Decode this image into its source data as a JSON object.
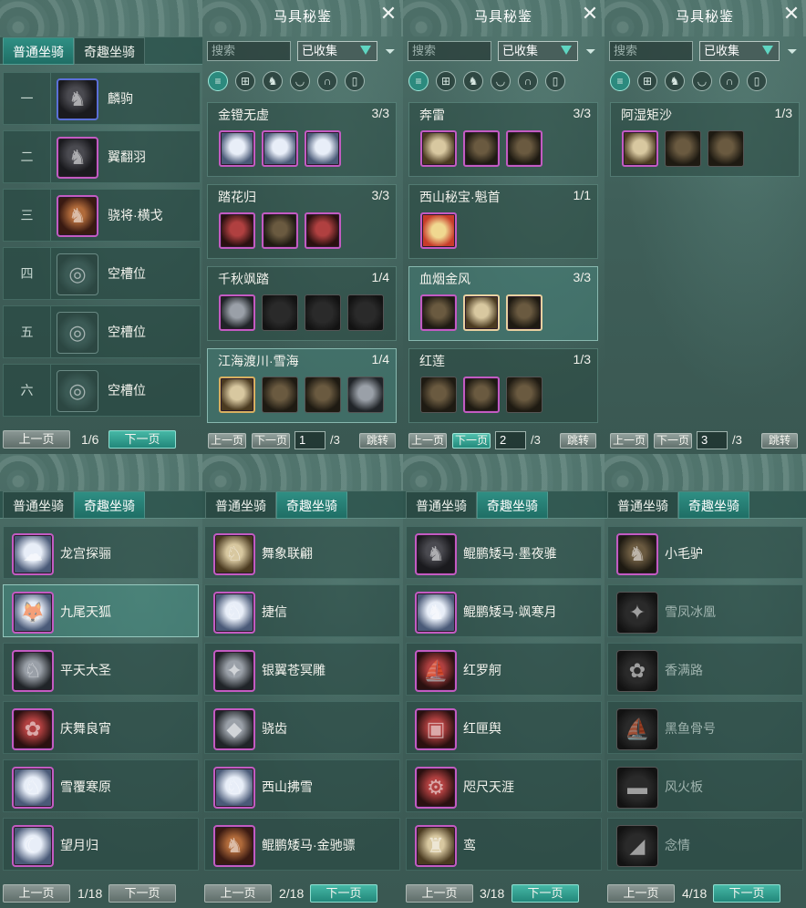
{
  "tabs": {
    "normal": "普通坐骑",
    "fun": "奇趣坐骑"
  },
  "normal_mounts": [
    {
      "num": "一",
      "name": "麟驹",
      "icon": "black-horse-icon"
    },
    {
      "num": "二",
      "name": "翼翻羽",
      "icon": "black-horse-icon"
    },
    {
      "num": "三",
      "name": "骁将·横戈",
      "icon": "war-horse-icon"
    },
    {
      "num": "四",
      "name": "空槽位",
      "icon": "empty-slot-icon"
    },
    {
      "num": "五",
      "name": "空槽位",
      "icon": "empty-slot-icon"
    },
    {
      "num": "六",
      "name": "空槽位",
      "icon": "empty-slot-icon"
    }
  ],
  "normal_pager": {
    "prev": "上一页",
    "next": "下一页",
    "page": "1/6"
  },
  "gear_panels": [
    {
      "title": "马具秘鉴",
      "search_placeholder": "搜索",
      "filter_value": "已收集",
      "page": "1",
      "total": "/3",
      "sets": [
        {
          "name": "金镫无虚",
          "count": "3/3"
        },
        {
          "name": "踏花归",
          "count": "3/3"
        },
        {
          "name": "千秋飒踏",
          "count": "1/4"
        },
        {
          "name": "江海渡川·雪海",
          "count": "1/4"
        }
      ]
    },
    {
      "title": "马具秘鉴",
      "search_placeholder": "搜索",
      "filter_value": "已收集",
      "page": "2",
      "total": "/3",
      "sets": [
        {
          "name": "奔雷",
          "count": "3/3"
        },
        {
          "name": "西山秘宝·魁首",
          "count": "1/1"
        },
        {
          "name": "血烟金风",
          "count": "3/3"
        },
        {
          "name": "红莲",
          "count": "1/3"
        }
      ]
    },
    {
      "title": "马具秘鉴",
      "search_placeholder": "搜索",
      "filter_value": "已收集",
      "page": "3",
      "total": "/3",
      "sets": [
        {
          "name": "阿湿矩沙",
          "count": "1/3"
        }
      ]
    }
  ],
  "gear_pager": {
    "prev": "上一页",
    "next": "下一页",
    "jump": "跳转"
  },
  "fun_panels": [
    {
      "page": "1/18",
      "items": [
        "龙宫探骊",
        "九尾天狐",
        "平天大圣",
        "庆舞良宵",
        "雪覆寒原",
        "望月归"
      ]
    },
    {
      "page": "2/18",
      "items": [
        "舞象联翩",
        "捷信",
        "银翼苍冥雕",
        "骁齿",
        "西山拂雪",
        "鲲鹏矮马·金驰骠"
      ]
    },
    {
      "page": "3/18",
      "items": [
        "鲲鹏矮马·墨夜骓",
        "鲲鹏矮马·飒寒月",
        "红罗舸",
        "红匣舆",
        "咫尺天涯",
        "鸾"
      ]
    },
    {
      "page": "4/18",
      "items": [
        "小毛驴",
        "雪凤冰凰",
        "香满路",
        "黑鱼骨号",
        "风火板",
        "念情"
      ]
    }
  ],
  "fun_pager": {
    "prev": "上一页",
    "next": "下一页"
  },
  "colors": {
    "accent": "#2c8a7e",
    "rare_border": "#c35bc2",
    "epic_border": "#5b6fd8"
  }
}
